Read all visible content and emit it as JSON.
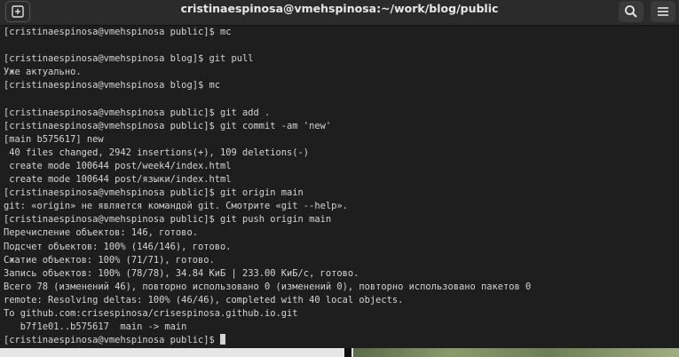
{
  "window": {
    "title": "cristinaespinosa@vmehspinosa:~/work/blog/public"
  },
  "header": {
    "new_tab_icon": "new-tab-icon",
    "search_icon": "search-icon",
    "menu_icon": "hamburger-menu-icon"
  },
  "terminal": {
    "lines": [
      "[cristinaespinosa@vmehspinosa public]$ mc",
      "",
      "[cristinaespinosa@vmehspinosa blog]$ git pull",
      "Уже актуально.",
      "[cristinaespinosa@vmehspinosa blog]$ mc",
      "",
      "[cristinaespinosa@vmehspinosa public]$ git add .",
      "[cristinaespinosa@vmehspinosa public]$ git commit -am 'new'",
      "[main b575617] new",
      " 40 files changed, 2942 insertions(+), 109 deletions(-)",
      " create mode 100644 post/week4/index.html",
      " create mode 100644 post/языки/index.html",
      "[cristinaespinosa@vmehspinosa public]$ git origin main",
      "git: «origin» не является командой git. Смотрите «git --help».",
      "[cristinaespinosa@vmehspinosa public]$ git push origin main",
      "Перечисление объектов: 146, готово.",
      "Подсчет объектов: 100% (146/146), готово.",
      "Сжатие объектов: 100% (71/71), готово.",
      "Запись объектов: 100% (78/78), 34.84 КиБ | 233.00 КиБ/с, готово.",
      "Всего 78 (изменений 46), повторно использовано 0 (изменений 0), повторно использовано пакетов 0",
      "remote: Resolving deltas: 100% (46/46), completed with 40 local objects.",
      "To github.com:crisespinosa/crisespinosa.github.io.git",
      "   b7f1e01..b575617  main -> main"
    ],
    "prompt": "[cristinaespinosa@vmehspinosa public]$ "
  }
}
